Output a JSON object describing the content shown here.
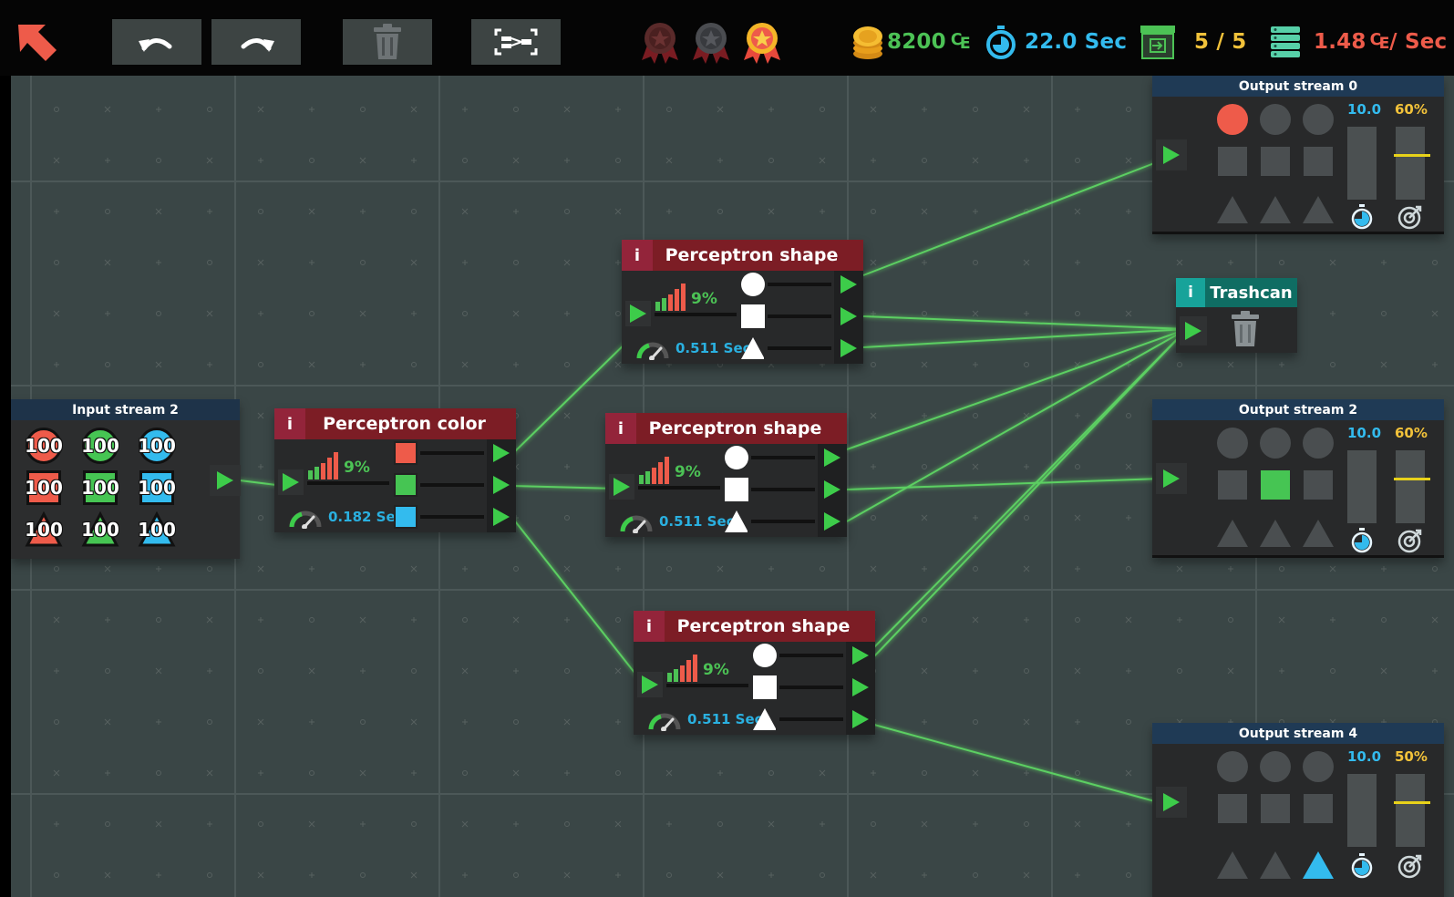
{
  "toolbar": {
    "buttons": [
      "back",
      "undo",
      "redo",
      "delete",
      "auto-layout"
    ],
    "medals": [
      {
        "name": "medal-bronze",
        "earned": false
      },
      {
        "name": "medal-silver",
        "earned": false
      },
      {
        "name": "medal-gold",
        "earned": true
      }
    ],
    "money": "8200",
    "money_unit": "₠",
    "time": "22.0 Sec",
    "streams": "5 / 5",
    "rate": "1.48",
    "rate_unit": "₠/ Sec"
  },
  "input_stream": {
    "title": "Input stream 2",
    "tokens": [
      {
        "shape": "circle",
        "color": "#ee5b4a",
        "count": "100"
      },
      {
        "shape": "circle",
        "color": "#46c553",
        "count": "100"
      },
      {
        "shape": "circle",
        "color": "#33bbee",
        "count": "100"
      },
      {
        "shape": "square",
        "color": "#ee5b4a",
        "count": "100"
      },
      {
        "shape": "square",
        "color": "#46c553",
        "count": "100"
      },
      {
        "shape": "square",
        "color": "#33bbee",
        "count": "100"
      },
      {
        "shape": "triangle",
        "color": "#ee5b4a",
        "count": "100"
      },
      {
        "shape": "triangle",
        "color": "#46c553",
        "count": "100"
      },
      {
        "shape": "triangle",
        "color": "#33bbee",
        "count": "100"
      }
    ]
  },
  "perceptrons": [
    {
      "info": "i",
      "title": "Perceptron color",
      "accuracy": "9%",
      "time": "0.182 Sec",
      "kind": "color"
    },
    {
      "info": "i",
      "title": "Perceptron shape",
      "accuracy": "9%",
      "time": "0.511 Sec",
      "kind": "shape"
    },
    {
      "info": "i",
      "title": "Perceptron shape",
      "accuracy": "9%",
      "time": "0.511 Sec",
      "kind": "shape"
    },
    {
      "info": "i",
      "title": "Perceptron shape",
      "accuracy": "9%",
      "time": "0.511 Sec",
      "kind": "shape"
    }
  ],
  "trashcan": {
    "info": "i",
    "title": "Trashcan"
  },
  "output_streams": [
    {
      "title": "Output stream 0",
      "speed": "10.0",
      "accuracy": "60%",
      "target": {
        "shape": "circle",
        "index": 0,
        "color": "#ee5b4a"
      }
    },
    {
      "title": "Output stream 2",
      "speed": "10.0",
      "accuracy": "60%",
      "target": {
        "shape": "square",
        "index": 1,
        "color": "#46c553"
      }
    },
    {
      "title": "Output stream 4",
      "speed": "10.0",
      "accuracy": "50%",
      "target": {
        "shape": "triangle",
        "index": 2,
        "color": "#33bbee"
      }
    }
  ],
  "colors": {
    "accent_red": "#ee5b4a",
    "money_green": "#4cc255",
    "time_blue": "#33bbee",
    "streams_yellow": "#f2c23a",
    "wire_green": "#5ccf62",
    "perceptron_header": "#7c1d25",
    "trashcan_header": "#0f6d63"
  }
}
